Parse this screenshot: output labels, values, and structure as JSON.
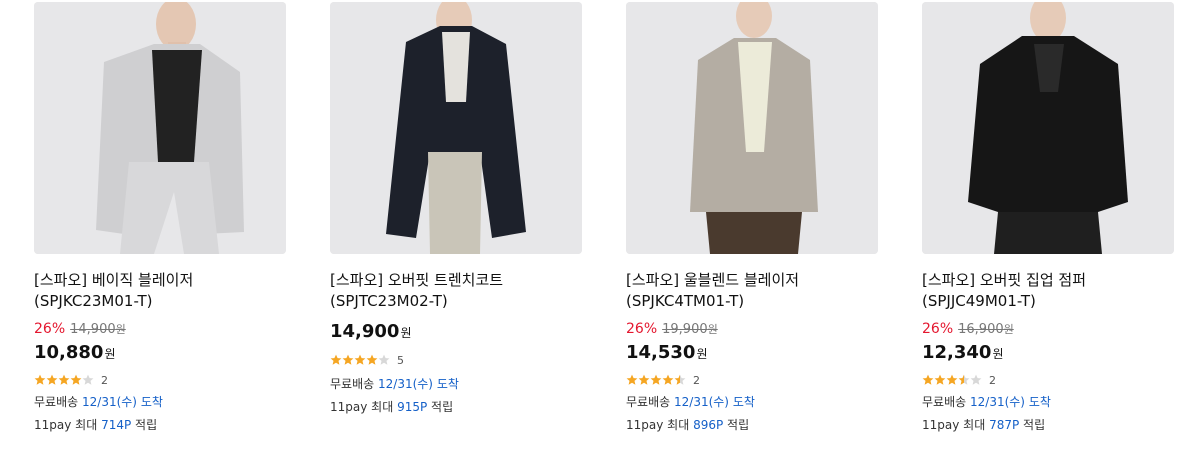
{
  "products": [
    {
      "title": "[스파오] 베이직 블레이저 (SPJKC23M01-T)",
      "discount": "26%",
      "original_price": "14,900",
      "original_unit": "원",
      "sale_price": "10,880",
      "sale_unit": "원",
      "rating": 4,
      "review_count": "2",
      "shipping_label": "무료배송",
      "arrival_date": "12/31(수)",
      "arrival_text": "도착",
      "pay_prefix": "11pay 최대",
      "points": "714P",
      "pay_suffix": "적립",
      "coat_color": "#cfcfd1"
    },
    {
      "title": "[스파오] 오버핏 트렌치코트 (SPJTC23M02-T)",
      "sale_price": "14,900",
      "sale_unit": "원",
      "rating": 4,
      "review_count": "5",
      "shipping_label": "무료배송",
      "arrival_date": "12/31(수)",
      "arrival_text": "도착",
      "pay_prefix": "11pay 최대",
      "points": "915P",
      "pay_suffix": "적립",
      "coat_color": "#1d212b"
    },
    {
      "title": "[스파오] 울블렌드 블레이저 (SPJKC4TM01-T)",
      "discount": "26%",
      "original_price": "19,900",
      "original_unit": "원",
      "sale_price": "14,530",
      "sale_unit": "원",
      "rating": 4.5,
      "review_count": "2",
      "shipping_label": "무료배송",
      "arrival_date": "12/31(수)",
      "arrival_text": "도착",
      "pay_prefix": "11pay 최대",
      "points": "896P",
      "pay_suffix": "적립",
      "coat_color": "#b4ada3"
    },
    {
      "title": "[스파오] 오버핏 집업 점퍼 (SPJJC49M01-T)",
      "discount": "26%",
      "original_price": "16,900",
      "original_unit": "원",
      "sale_price": "12,340",
      "sale_unit": "원",
      "rating": 3.5,
      "review_count": "2",
      "shipping_label": "무료배송",
      "arrival_date": "12/31(수)",
      "arrival_text": "도착",
      "pay_prefix": "11pay 최대",
      "points": "787P",
      "pay_suffix": "적립",
      "coat_color": "#161616"
    }
  ],
  "colors": {
    "discount": "#e4172f",
    "link_blue": "#1560c8",
    "star_filled": "#f5a623",
    "star_empty": "#d8d8d8",
    "image_bg": "#e7e7e9"
  }
}
